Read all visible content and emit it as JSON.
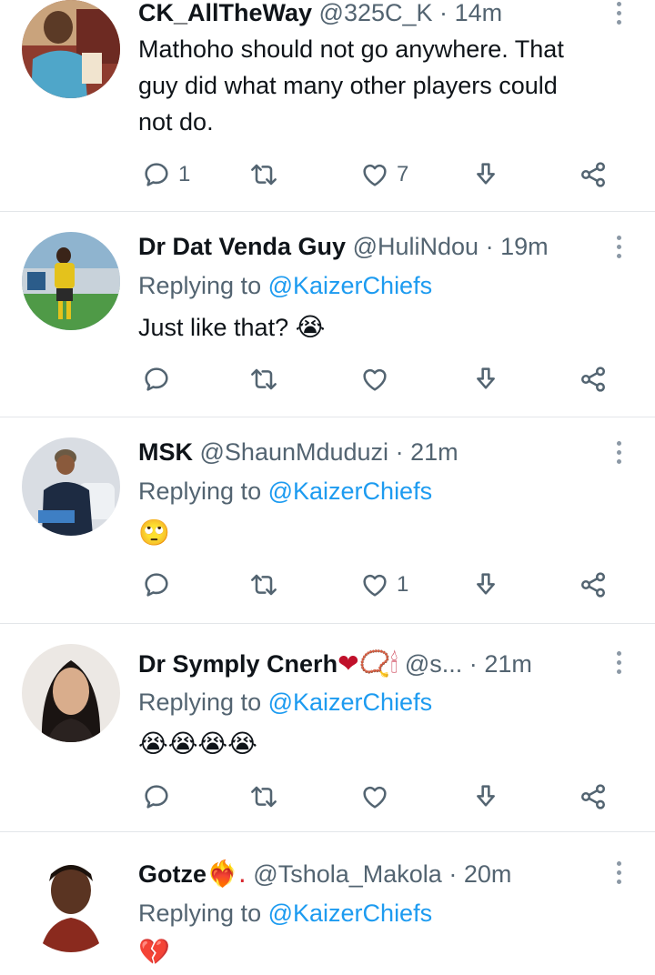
{
  "colors": {
    "link": "#1d9bf0",
    "muted": "#536471",
    "text": "#0f1419",
    "divider": "#e3e6e9"
  },
  "tweets": [
    {
      "name": "CK_AllTheWay",
      "handle": "@325C_K",
      "separator": "·",
      "time": "14m",
      "replying_label": "",
      "replying_mention": "",
      "text_lines": [
        "Mathoho should not go anywhere. That",
        "guy did what many other players could",
        "not do."
      ],
      "emoji": "",
      "reply_count": "1",
      "retweet_count": "",
      "like_count": "7"
    },
    {
      "name": "Dr Dat Venda Guy",
      "handle": "@HuliNdou",
      "separator": "·",
      "time": "19m",
      "replying_label": "Replying to",
      "replying_mention": "@KaizerChiefs",
      "text": "Just like that?",
      "emoji": "😭",
      "reply_count": "",
      "retweet_count": "",
      "like_count": ""
    },
    {
      "name": "MSK",
      "handle": "@ShaunMduduzi",
      "separator": "·",
      "time": "21m",
      "replying_label": "Replying to",
      "replying_mention": "@KaizerChiefs",
      "text": "",
      "emoji": "🙄",
      "reply_count": "",
      "retweet_count": "",
      "like_count": "1"
    },
    {
      "name": "Dr Symply Cnerh",
      "name_emoji": "❤📿🕯",
      "handle": "@s...",
      "separator": "·",
      "time": "21m",
      "replying_label": "Replying to",
      "replying_mention": "@KaizerChiefs",
      "text": "",
      "emoji": "😭😭😭😭",
      "reply_count": "",
      "retweet_count": "",
      "like_count": ""
    },
    {
      "name": "Gotze",
      "name_emoji": "❤‍🔥.",
      "handle": "@Tshola_Makola",
      "separator": "·",
      "time": "20m",
      "replying_label": "Replying to",
      "replying_mention": "@KaizerChiefs",
      "text": "",
      "emoji": "💔"
    }
  ]
}
